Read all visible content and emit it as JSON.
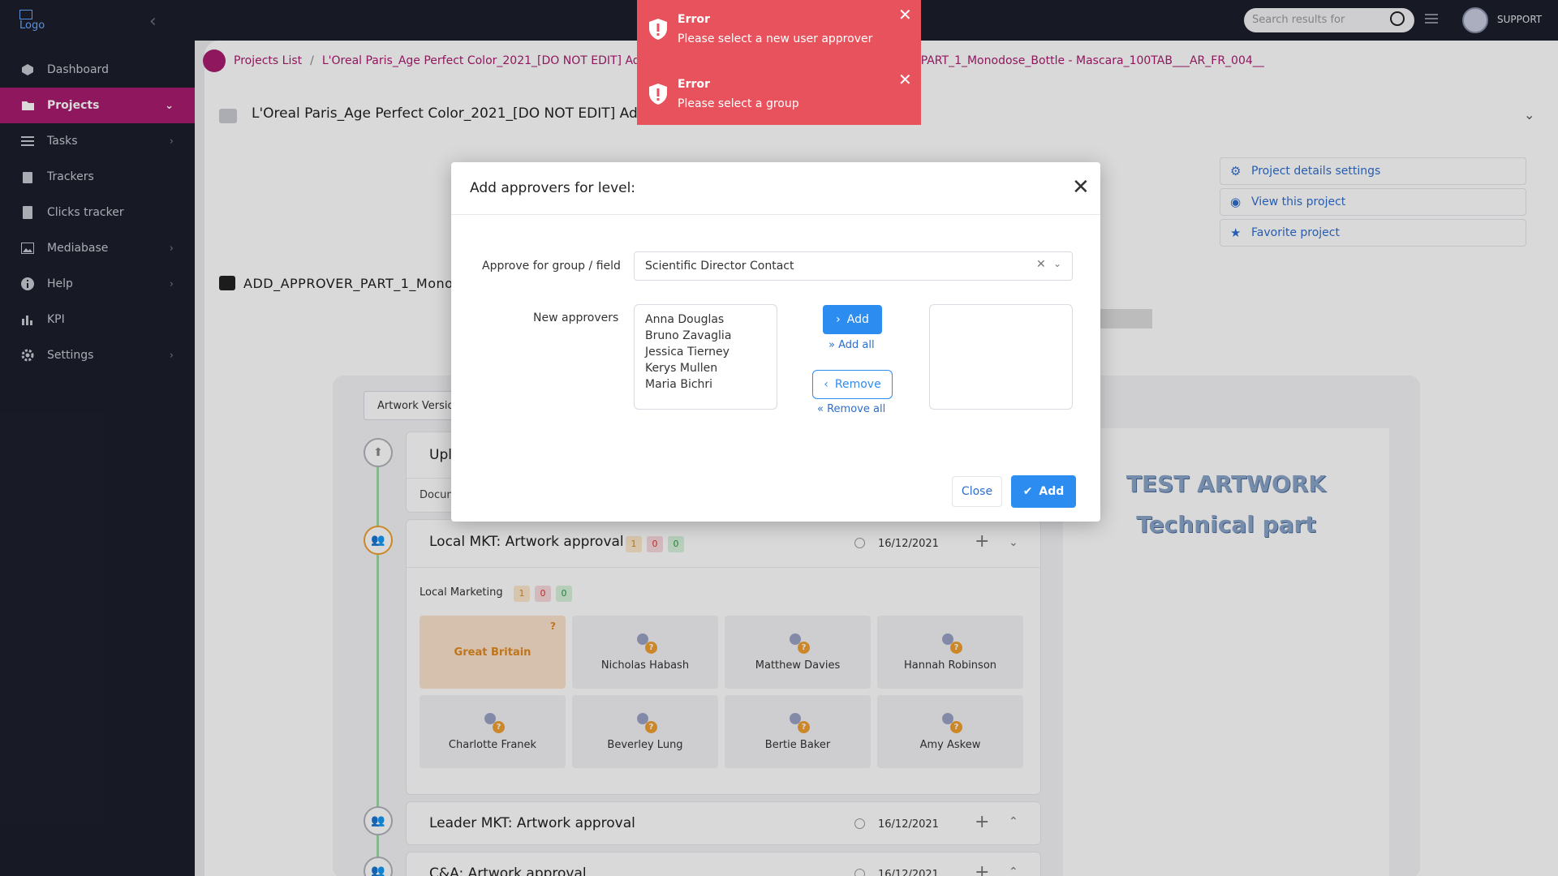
{
  "sidebar": {
    "logo_alt": "Logo",
    "items": [
      {
        "label": "Dashboard"
      },
      {
        "label": "Projects"
      },
      {
        "label": "Tasks"
      },
      {
        "label": "Trackers"
      },
      {
        "label": "Clicks tracker"
      },
      {
        "label": "Mediabase"
      },
      {
        "label": "Help"
      },
      {
        "label": "KPI"
      },
      {
        "label": "Settings"
      }
    ]
  },
  "topbar": {
    "search_placeholder": "Search results for",
    "user_label": "SUPPORT"
  },
  "breadcrumb": {
    "root": "Projects List",
    "separator": "/",
    "current": "L'Oreal Paris_Age Perfect Color_2021_[DO NOT EDIT] Add approver PART 3 - MI003392 / ADD_APPROVER_PART_1_Monodose_Bottle - Mascara_100TAB___AR_FR_004__"
  },
  "project": {
    "title": "L'Oreal Paris_Age Perfect Color_2021_[DO NOT EDIT] Add approver PART 3 - MI003392",
    "task_title": "ADD_APPROVER_PART_1_Monodose"
  },
  "side_links": {
    "settings": "Project details settings",
    "view": "View this project",
    "favorite": "Favorite project"
  },
  "artwork": {
    "tab_label": "Artwork Version",
    "line1": "TEST ARTWORK",
    "line2": "Technical part"
  },
  "stages": {
    "upload": {
      "title": "Upload",
      "sub": "Document"
    },
    "local": {
      "title": "Local MKT: Artwork approval",
      "counts": [
        "1",
        "0",
        "0"
      ],
      "date": "16/12/2021",
      "group_label": "Local Marketing",
      "group_counts": [
        "1",
        "0",
        "0"
      ],
      "country": "Great Britain",
      "country_mark": "?",
      "people": [
        "Nicholas Habash",
        "Matthew Davies",
        "Hannah Robinson",
        "Charlotte Franek",
        "Beverley Lung",
        "Bertie Baker",
        "Amy Askew"
      ]
    },
    "leader": {
      "title": "Leader MKT: Artwork approval",
      "date": "16/12/2021"
    },
    "ca": {
      "title": "C&A: Artwork approval",
      "date": "16/12/2021"
    }
  },
  "modal": {
    "title": "Add approvers for level:",
    "group_label": "Approve for group / field",
    "group_value": "Scientific Director Contact",
    "approvers_label": "New approvers",
    "available": [
      "Anna Douglas",
      "Bruno Zavaglia",
      "Jessica Tierney",
      "Kerys Mullen",
      "Maria Bichri"
    ],
    "add_label": "Add",
    "add_all_label": "Add all",
    "remove_label": "Remove",
    "remove_all_label": "Remove all",
    "close_label": "Close",
    "submit_label": "Add"
  },
  "toasts": [
    {
      "title": "Error",
      "message": "Please select a new user approver"
    },
    {
      "title": "Error",
      "message": "Please select a group"
    }
  ],
  "colors": {
    "brand": "#a81c6e",
    "primary": "#2d8cf0",
    "error": "#e8525d",
    "sidebar": "#1c1f2b"
  }
}
